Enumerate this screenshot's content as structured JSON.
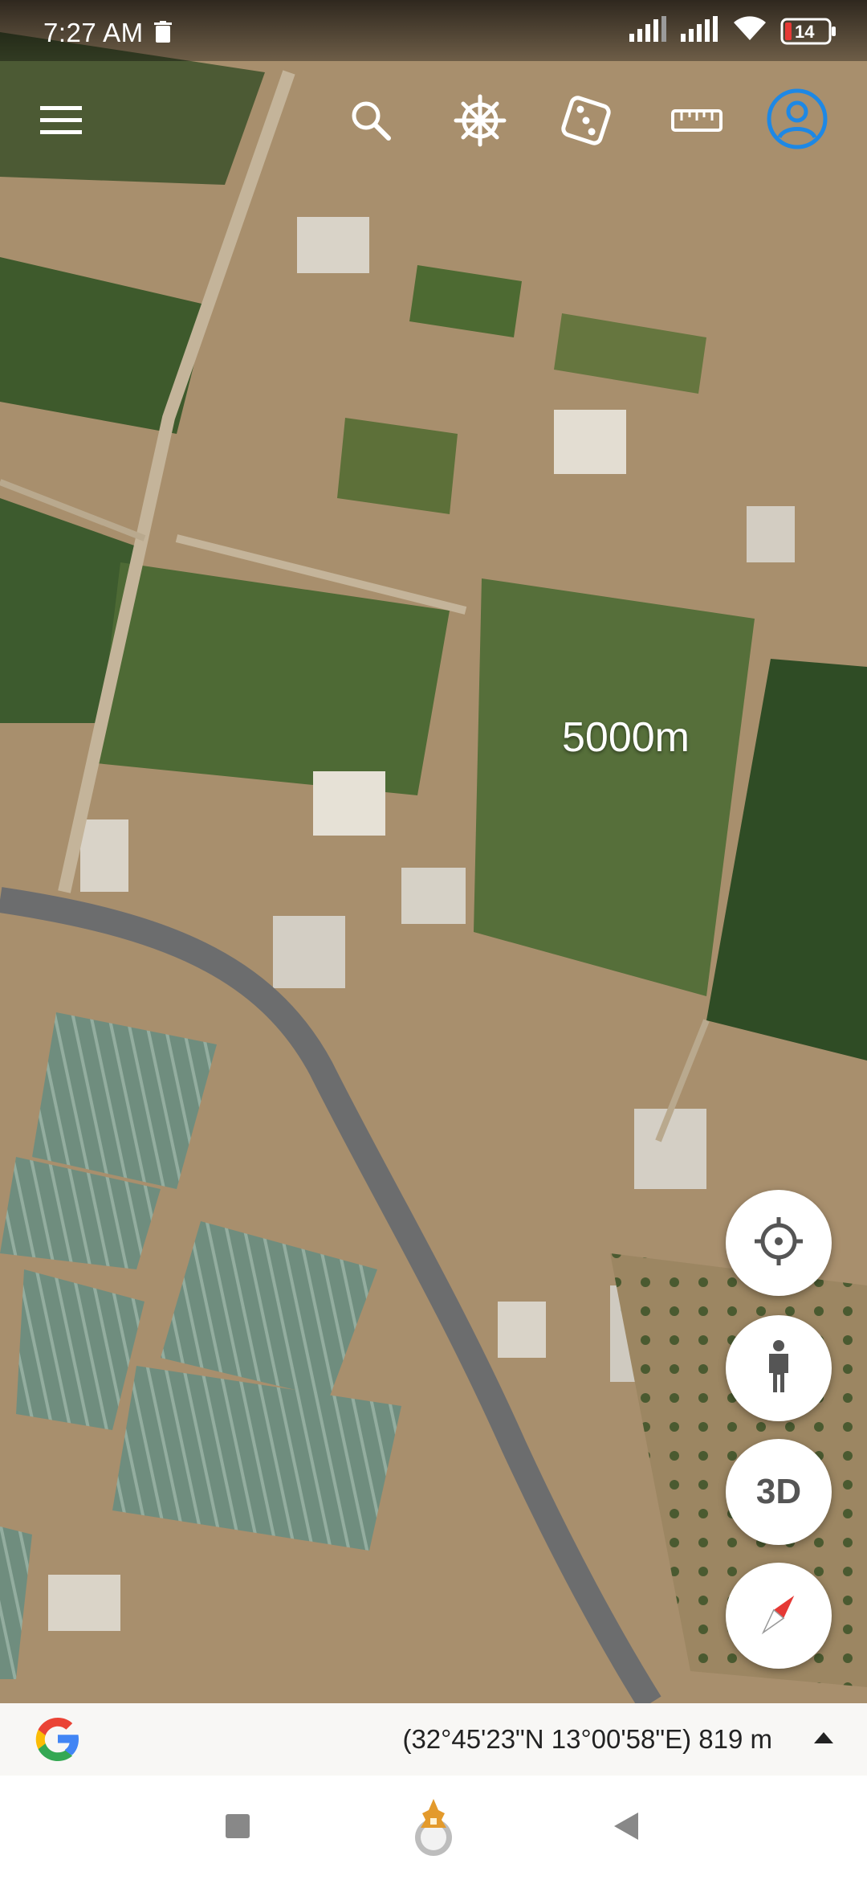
{
  "status_bar": {
    "time": "7:27 AM",
    "battery_level": "14",
    "icons": [
      "trash-icon",
      "signal-icon",
      "signal-icon",
      "wifi-icon",
      "battery-low-icon"
    ]
  },
  "toolbar": {
    "icons": [
      "menu-icon",
      "search-icon",
      "steering-wheel-icon",
      "dice-icon",
      "ruler-icon",
      "account-icon"
    ],
    "account_color": "#1e88e5"
  },
  "map": {
    "distance_label": "5000m"
  },
  "fabs": {
    "three_d_label": "3D",
    "icons": [
      "location-crosshair-icon",
      "street-view-person-icon",
      "compass-icon"
    ],
    "compass_color": "#e53935"
  },
  "info_bar": {
    "coordinates": "(32°45'23\"N 13°00'58\"E) 819 m",
    "logo": "google-g-logo"
  },
  "nav_bar": {
    "icons": [
      "square-recents-icon",
      "app-home-icon",
      "triangle-back-icon"
    ]
  }
}
